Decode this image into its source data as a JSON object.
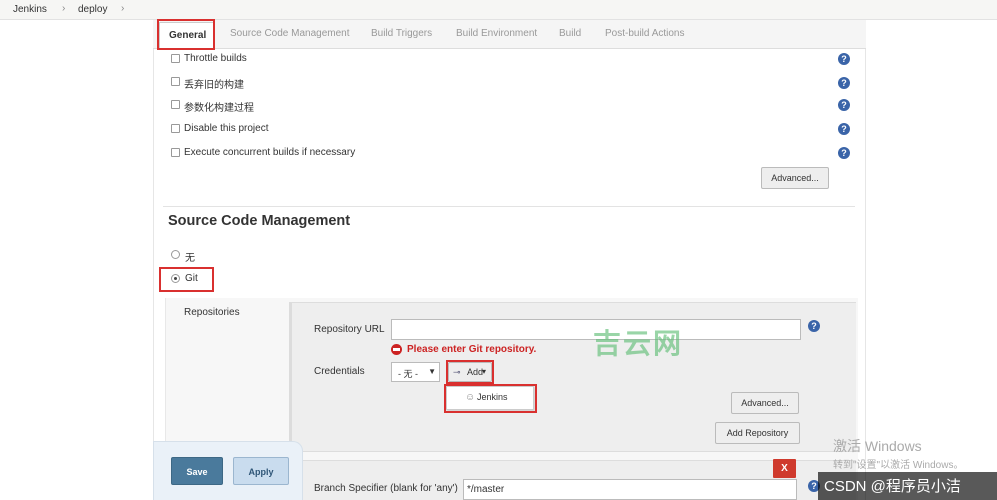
{
  "breadcrumb": [
    "Jenkins",
    "deploy"
  ],
  "tabs": [
    {
      "label": "General",
      "active": true
    },
    {
      "label": "Source Code Management"
    },
    {
      "label": "Build Triggers"
    },
    {
      "label": "Build Environment"
    },
    {
      "label": "Build"
    },
    {
      "label": "Post-build Actions"
    }
  ],
  "general": {
    "options": [
      {
        "label": "Throttle builds",
        "checked": false
      },
      {
        "label": "丢弃旧的构建",
        "checked": false
      },
      {
        "label": "参数化构建过程",
        "checked": false
      },
      {
        "label": "Disable this project",
        "checked": false
      },
      {
        "label": "Execute concurrent builds if necessary",
        "checked": false
      }
    ],
    "advanced_label": "Advanced..."
  },
  "scm": {
    "title": "Source Code Management",
    "options": [
      {
        "label": "无",
        "selected": false
      },
      {
        "label": "Git",
        "selected": true
      }
    ],
    "repositories_label": "Repositories",
    "repo_url_label": "Repository URL",
    "repo_url_value": "",
    "error": "Please enter Git repository.",
    "credentials_label": "Credentials",
    "credentials_value": "- 无 -",
    "add_label": "Add",
    "dropdown_item": "Jenkins",
    "advanced_label": "Advanced...",
    "add_repository_label": "Add Repository",
    "delete_label": "X",
    "branch_label": "Branch Specifier (blank for 'any')",
    "branch_value": "*/master"
  },
  "actions": {
    "save": "Save",
    "apply": "Apply"
  },
  "help_glyph": "?",
  "overlays": {
    "watermark": "吉云网",
    "windows_line1": "激活 Windows",
    "windows_line2": "转到\"设置\"以激活 Windows。",
    "csdn": "CSDN @程序员小洁"
  },
  "colors": {
    "highlight": "#d9302f",
    "error": "#cc2222",
    "save": "#4a7a9c",
    "help": "#3a64a8"
  }
}
